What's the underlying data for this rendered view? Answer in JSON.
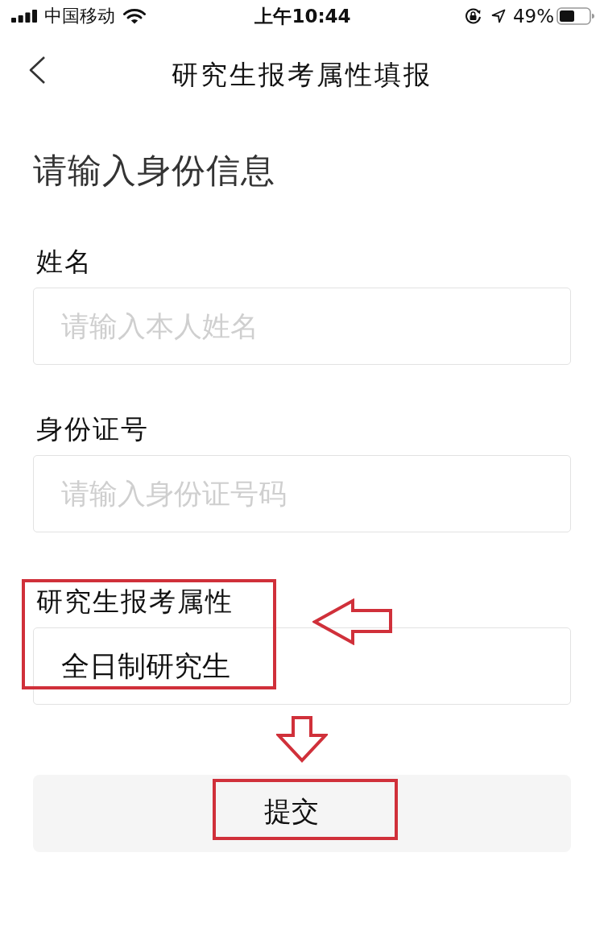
{
  "status_bar": {
    "carrier": "中国移动",
    "time": "上午10:44",
    "battery": "49%"
  },
  "nav_bar": {
    "title": "研究生报考属性填报"
  },
  "form": {
    "heading": "请输入身份信息",
    "fields": [
      {
        "label": "姓名",
        "placeholder": "请输入本人姓名",
        "highlighted": false
      },
      {
        "label": "身份证号",
        "placeholder": "请输入身份证号码",
        "highlighted": false
      },
      {
        "label": "研究生报考属性",
        "value": "全日制研究生",
        "highlighted": true
      }
    ],
    "submit": {
      "label": "提交",
      "highlighted": true
    }
  }
}
